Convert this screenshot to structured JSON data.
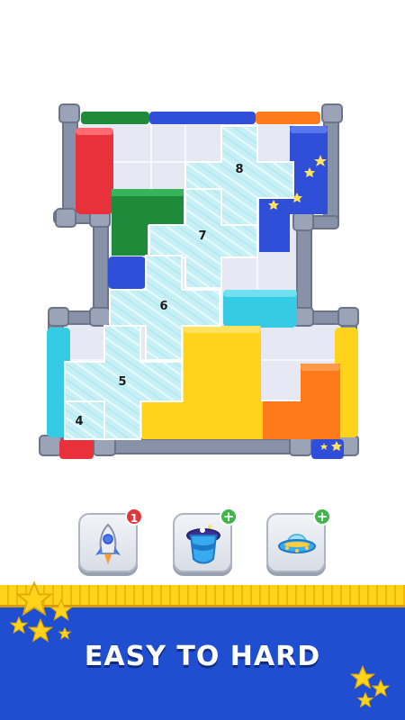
{
  "board": {
    "tiles": [
      {
        "number": "8"
      },
      {
        "number": "7"
      },
      {
        "number": "6"
      },
      {
        "number": "5"
      },
      {
        "number": "4"
      }
    ],
    "colors": {
      "red": "#e8313b",
      "green": "#1e8a3a",
      "blue": "#2f4fd8",
      "cyan": "#36cbe4",
      "yellow": "#ffd21c",
      "orange": "#ff7a1a",
      "ice": "#bfeef5"
    }
  },
  "boosters": [
    {
      "icon": "rocket-icon",
      "badge": "1",
      "badge_type": "count"
    },
    {
      "icon": "magic-hat-icon",
      "badge": "+",
      "badge_type": "add"
    },
    {
      "icon": "ufo-icon",
      "badge": "+",
      "badge_type": "add"
    }
  ],
  "banner": {
    "text": "EASY TO HARD",
    "colors": {
      "background": "#1f4fd0",
      "stripe": "#ffd21c"
    }
  }
}
